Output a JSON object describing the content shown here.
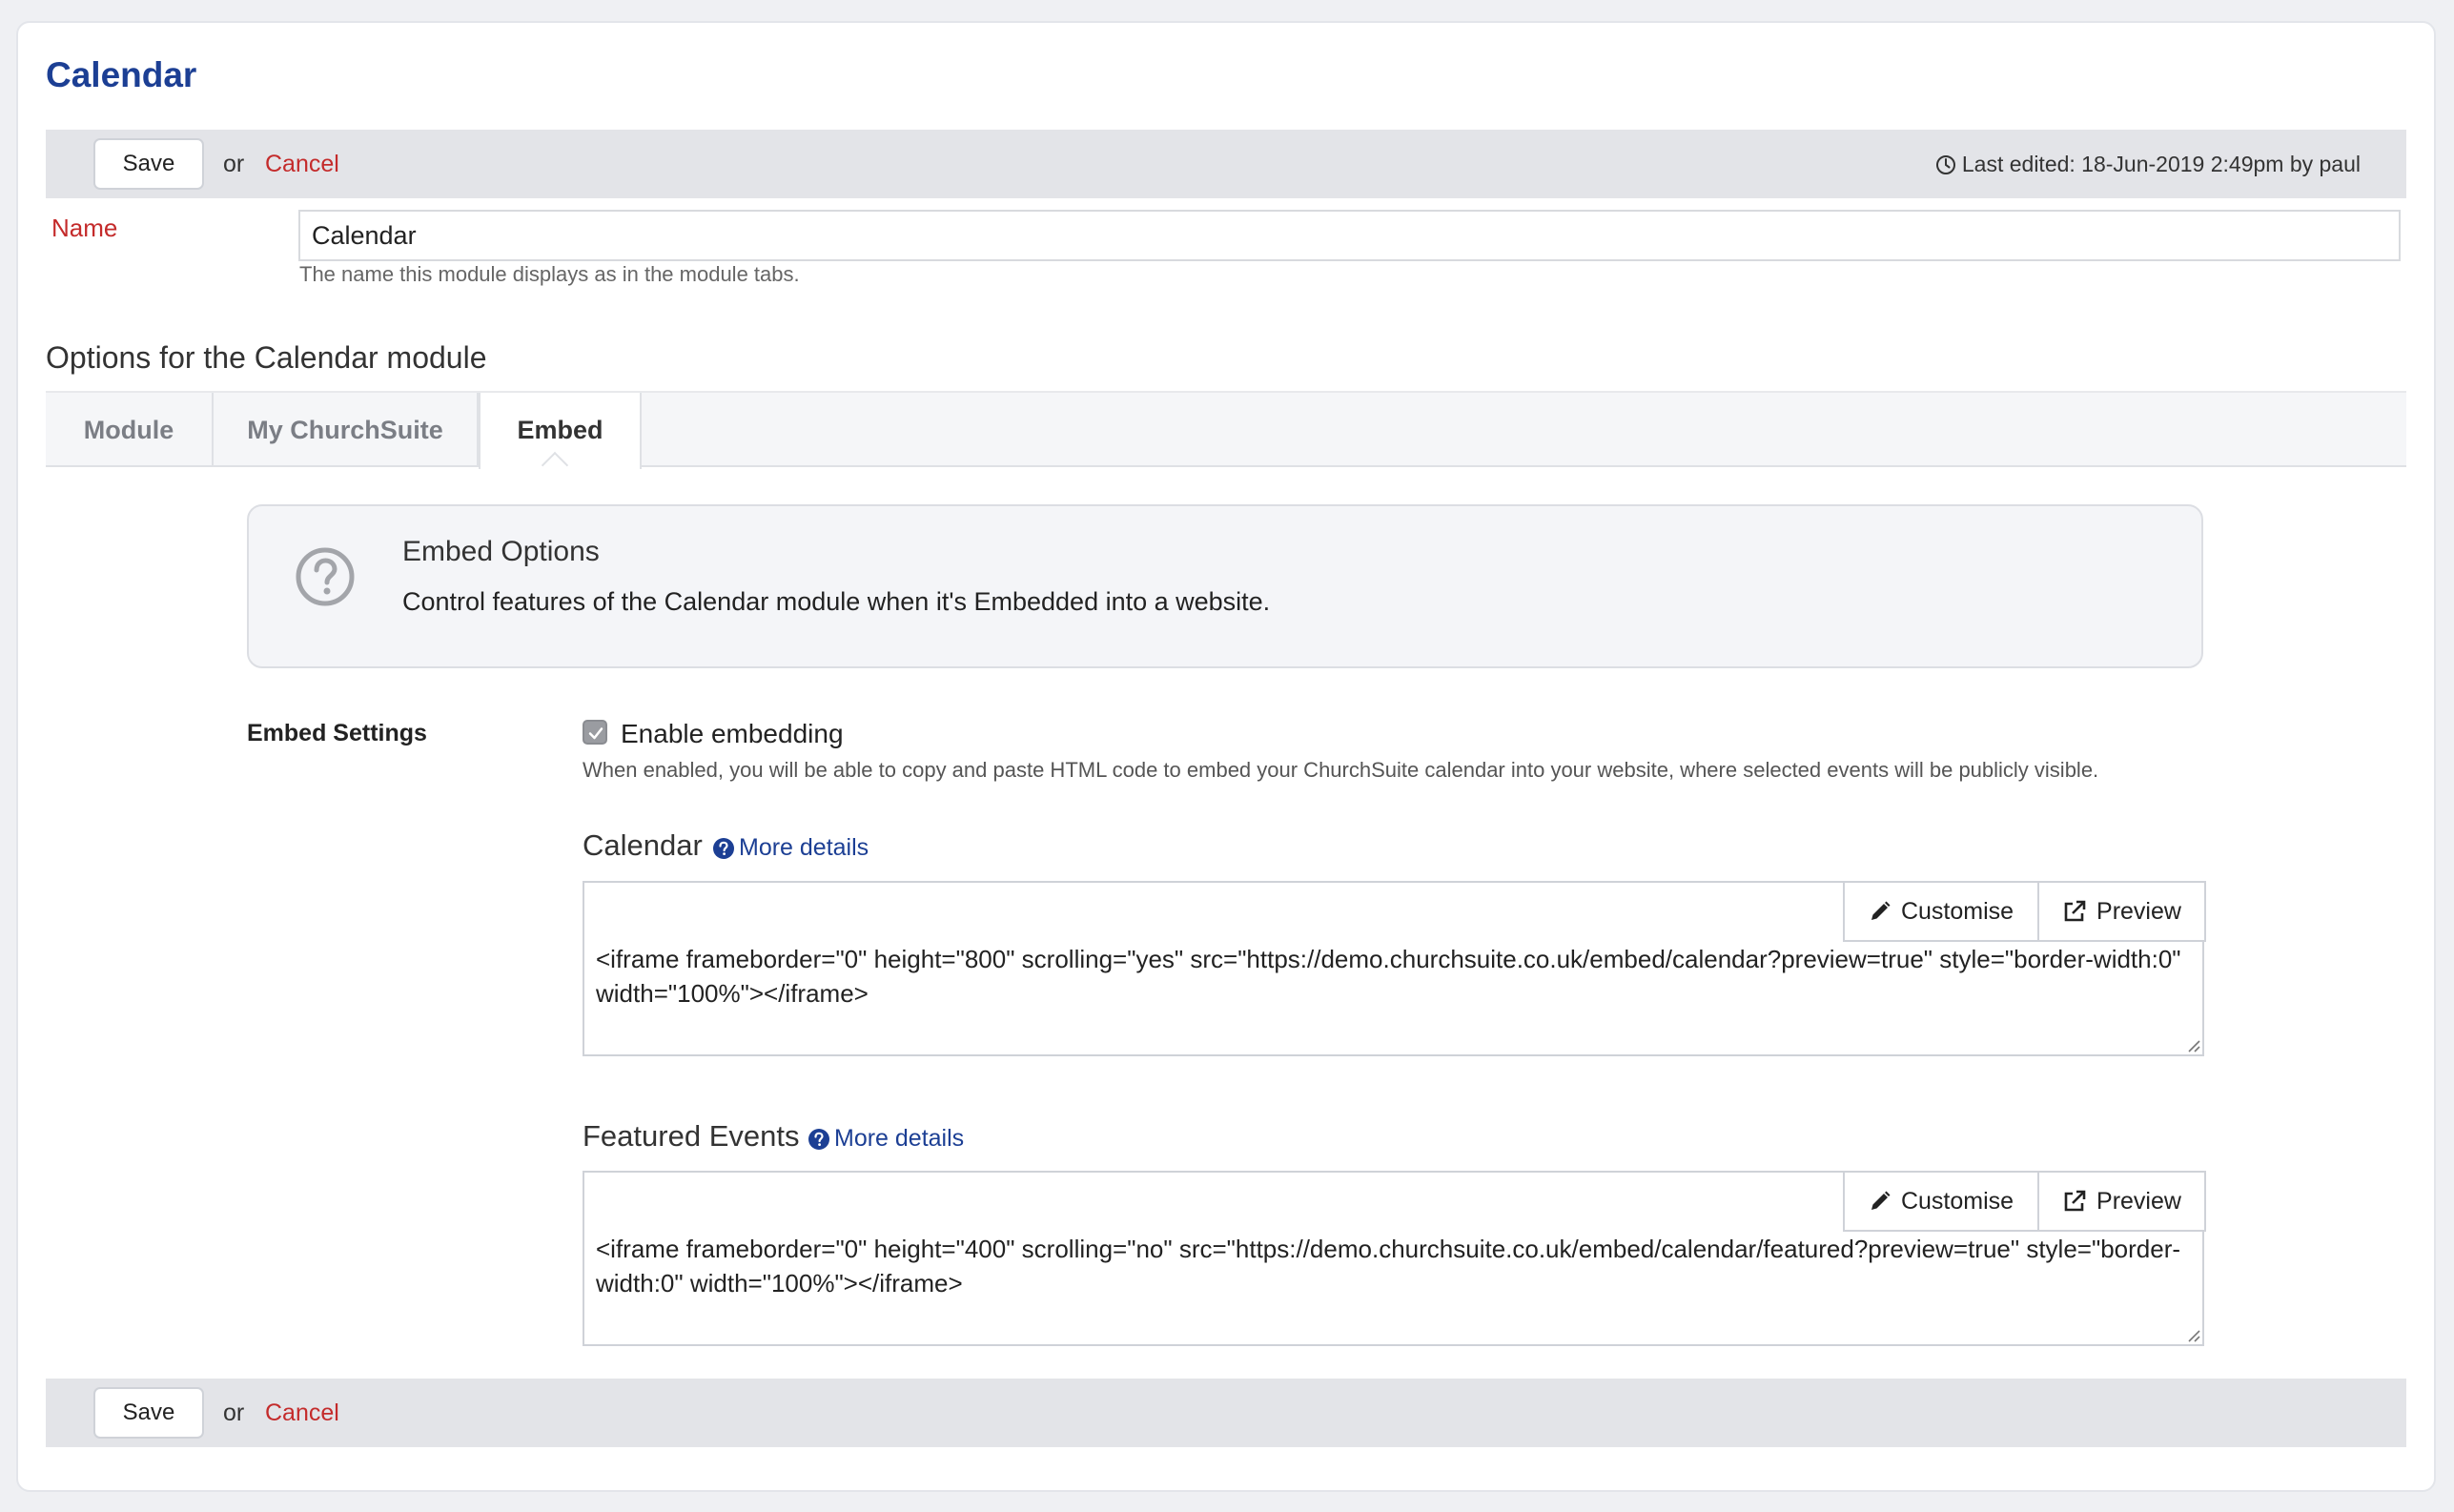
{
  "page": {
    "title": "Calendar"
  },
  "toolbar": {
    "save_label": "Save",
    "or_text": "or",
    "cancel_label": "Cancel",
    "last_edited": "Last edited: 18-Jun-2019 2:49pm by paul"
  },
  "name_field": {
    "label": "Name",
    "value": "Calendar",
    "help": "The name this module displays as in the module tabs."
  },
  "options": {
    "heading": "Options for the Calendar module",
    "tabs": [
      {
        "label": "Module"
      },
      {
        "label": "My ChurchSuite"
      },
      {
        "label": "Embed"
      }
    ],
    "active_tab": "Embed"
  },
  "info_box": {
    "title": "Embed Options",
    "text": "Control features of the Calendar module when it's Embedded into a website."
  },
  "embed_settings": {
    "label": "Embed Settings",
    "enable_label": "Enable embedding",
    "enabled": true,
    "help": "When enabled, you will be able to copy and paste HTML code to embed your ChurchSuite calendar into your website, where selected events will be publicly visible."
  },
  "calendar_embed": {
    "title": "Calendar",
    "more_details": "More details",
    "customise_label": "Customise",
    "preview_label": "Preview",
    "code": "<iframe frameborder=\"0\" height=\"800\" scrolling=\"yes\" src=\"https://demo.churchsuite.co.uk/embed/calendar?preview=true\" style=\"border-width:0\" width=\"100%\"></iframe>"
  },
  "featured_embed": {
    "title": "Featured Events",
    "more_details": "More details",
    "customise_label": "Customise",
    "preview_label": "Preview",
    "code": "<iframe frameborder=\"0\" height=\"400\" scrolling=\"no\" src=\"https://demo.churchsuite.co.uk/embed/calendar/featured?preview=true\" style=\"border-width:0\" width=\"100%\"></iframe>"
  },
  "colors": {
    "title_blue": "#1c3f94",
    "cancel_red": "#c42b2b",
    "bar_gray": "#e3e4e8"
  },
  "icons": [
    "clock-icon",
    "question-circle-icon",
    "check-icon",
    "pencil-icon",
    "external-link-icon"
  ]
}
